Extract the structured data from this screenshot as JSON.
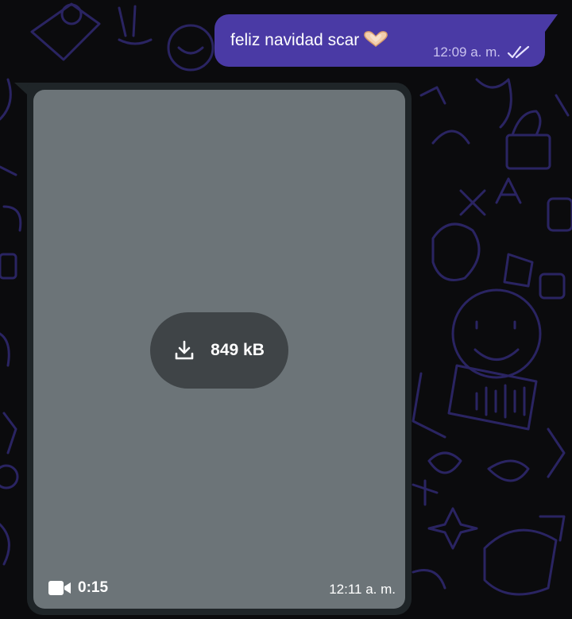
{
  "colors": {
    "background": "#0b0b0d",
    "wallpaper_doodle": "#2a2462",
    "outgoing_bubble": "#4a3aa5",
    "incoming_bubble": "#1f2528",
    "video_placeholder": "#6c7478",
    "download_pill": "#3f4447"
  },
  "outgoing_message": {
    "text": "feliz navidad scar",
    "emoji_icon": "heart-hands-emoji",
    "time": "12:09 a. m.",
    "status_icon": "double-check-read-icon"
  },
  "incoming_video": {
    "download_icon": "download-icon",
    "file_size": "849 kB",
    "duration_icon": "video-camera-icon",
    "duration": "0:15",
    "time": "12:11 a. m."
  }
}
